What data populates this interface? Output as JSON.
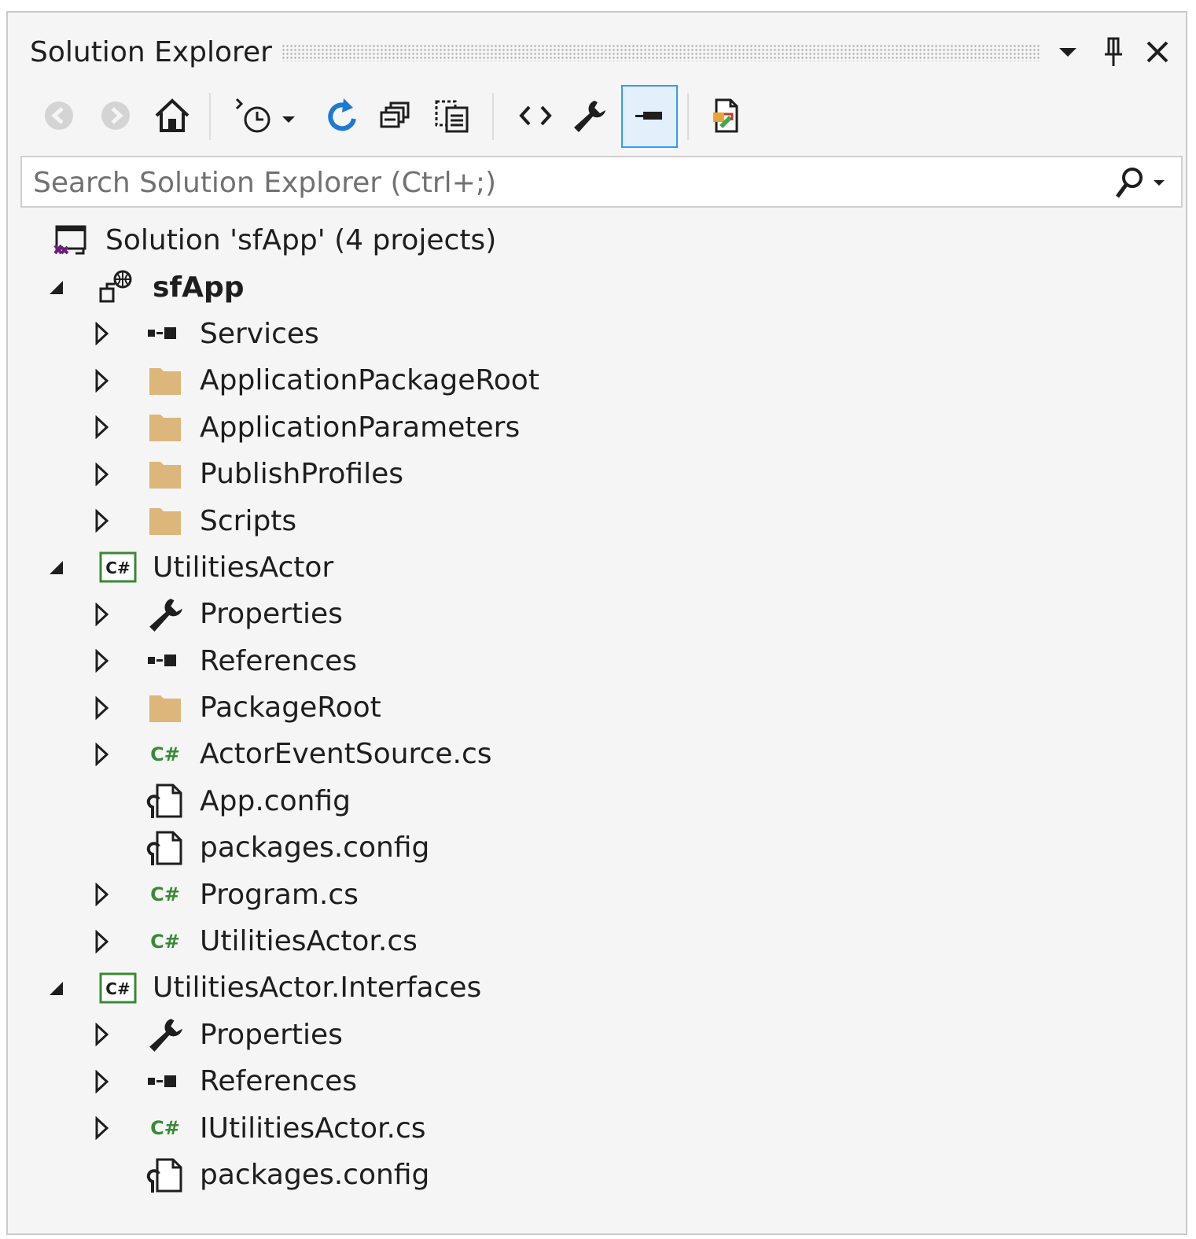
{
  "window": {
    "title": "Solution Explorer"
  },
  "toolbar": {
    "buttons": [
      {
        "name": "back-button",
        "icon": "back-arrow-icon"
      },
      {
        "name": "forward-button",
        "icon": "forward-arrow-icon"
      },
      {
        "name": "home-button",
        "icon": "home-icon"
      },
      {
        "name": "pending-changes-filter-button",
        "icon": "history-clock-icon"
      },
      {
        "name": "refresh-button",
        "icon": "refresh-icon"
      },
      {
        "name": "collapse-all-button",
        "icon": "collapse-all-icon"
      },
      {
        "name": "show-all-files-button",
        "icon": "show-all-files-icon"
      },
      {
        "name": "view-code-button",
        "icon": "code-brackets-icon"
      },
      {
        "name": "properties-button",
        "icon": "wrench-icon"
      },
      {
        "name": "preview-selected-items-button",
        "icon": "preview-icon",
        "active": true
      },
      {
        "name": "class-view-button",
        "icon": "class-diagram-icon"
      }
    ]
  },
  "search": {
    "placeholder": "Search Solution Explorer (Ctrl+;)",
    "value": ""
  },
  "tree": {
    "solution": "Solution 'sfApp' (4 projects)",
    "items": [
      {
        "label": "sfApp",
        "level": 1,
        "expander": "expanded",
        "icon": "service-fabric-app-icon",
        "bold": true
      },
      {
        "label": "Services",
        "level": 2,
        "expander": "collapsed",
        "icon": "references-icon"
      },
      {
        "label": "ApplicationPackageRoot",
        "level": 2,
        "expander": "collapsed",
        "icon": "folder-icon"
      },
      {
        "label": "ApplicationParameters",
        "level": 2,
        "expander": "collapsed",
        "icon": "folder-icon"
      },
      {
        "label": "PublishProfiles",
        "level": 2,
        "expander": "collapsed",
        "icon": "folder-icon"
      },
      {
        "label": "Scripts",
        "level": 2,
        "expander": "collapsed",
        "icon": "folder-icon"
      },
      {
        "label": "UtilitiesActor",
        "level": 1,
        "expander": "expanded",
        "icon": "csharp-project-icon"
      },
      {
        "label": "Properties",
        "level": 2,
        "expander": "collapsed",
        "icon": "wrench-icon"
      },
      {
        "label": "References",
        "level": 2,
        "expander": "collapsed",
        "icon": "references-icon"
      },
      {
        "label": "PackageRoot",
        "level": 2,
        "expander": "collapsed",
        "icon": "folder-icon"
      },
      {
        "label": "ActorEventSource.cs",
        "level": 2,
        "expander": "collapsed",
        "icon": "csharp-file-icon"
      },
      {
        "label": "App.config",
        "level": 2,
        "expander": "none",
        "icon": "config-file-icon"
      },
      {
        "label": "packages.config",
        "level": 2,
        "expander": "none",
        "icon": "config-file-icon"
      },
      {
        "label": "Program.cs",
        "level": 2,
        "expander": "collapsed",
        "icon": "csharp-file-icon"
      },
      {
        "label": "UtilitiesActor.cs",
        "level": 2,
        "expander": "collapsed",
        "icon": "csharp-file-icon"
      },
      {
        "label": "UtilitiesActor.Interfaces",
        "level": 1,
        "expander": "expanded",
        "icon": "csharp-project-icon"
      },
      {
        "label": "Properties",
        "level": 2,
        "expander": "collapsed",
        "icon": "wrench-icon"
      },
      {
        "label": "References",
        "level": 2,
        "expander": "collapsed",
        "icon": "references-icon"
      },
      {
        "label": "IUtilitiesActor.cs",
        "level": 2,
        "expander": "collapsed",
        "icon": "csharp-file-icon"
      },
      {
        "label": "packages.config",
        "level": 2,
        "expander": "none",
        "icon": "config-file-icon"
      }
    ]
  },
  "colors": {
    "panel_background": "#f5f5f5",
    "accent_blue": "#1e79d4",
    "active_border": "#3399ff",
    "folder": "#dcb67a",
    "csharp_green": "#388a34",
    "text": "#1e1e1e"
  }
}
